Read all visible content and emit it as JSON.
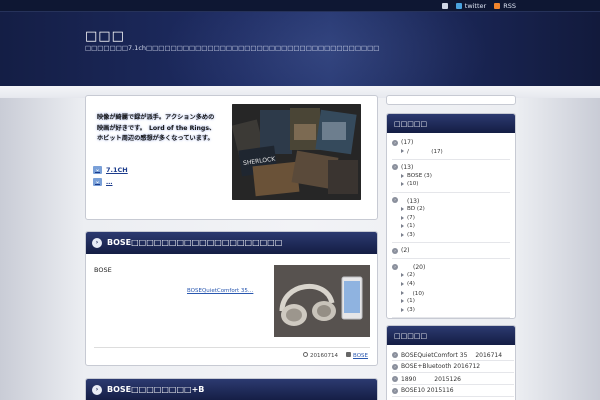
{
  "topbar": {
    "twitter_label": "twitter",
    "rss_label": "RSS"
  },
  "site": {
    "title": "□□□",
    "description": "□□□□□□□7.1ch□□□□□□□□□□□□□□□□□□□□□□□□□□□□□□□□□□□□□□"
  },
  "intro": {
    "text_lines": [
      "映像が綺麗で録が派手。アクション多めの",
      "映画が好きです。　Lord of the Rings、",
      "ホビット周辺の感想が多くなっています。"
    ],
    "links": [
      {
        "label": "7.1CH"
      },
      {
        "label": "…"
      }
    ]
  },
  "post": {
    "title": "BOSE□□□□□□□□□□□□□□□□□□□□",
    "excerpt": "BOSE",
    "readmore": "BOSEQuietComfort 35…",
    "date": "20160714",
    "category": "BOSE"
  },
  "post2": {
    "title": "BOSE□□□□□□□□+B"
  },
  "sidebar": {
    "categories_heading": "□□□□□",
    "categories": [
      {
        "label": "(17)",
        "children": [
          "/　　　　(17)"
        ]
      },
      {
        "label": "(13)",
        "children": [
          "BOSE (3)",
          "(10)"
        ]
      },
      {
        "label": "　(13)",
        "children": [
          "BD (2)",
          "(7)",
          "(1)",
          "(3)"
        ]
      },
      {
        "label": "(2)",
        "children": []
      },
      {
        "label": "　　(20)",
        "children": [
          "(2)",
          "(4)",
          "　(10)",
          "(1)",
          "(3)"
        ]
      }
    ],
    "recent_heading": "□□□□□",
    "recent": [
      "BOSEQuietComfort 35　 2016714",
      "BOSE+Bluetooth 2016712",
      "1890　　　2015126",
      "BOSE10 2015116"
    ]
  },
  "colors": {
    "header_dark": "#141e45",
    "panel_head": "#1c2754",
    "link": "#2a58b0"
  }
}
